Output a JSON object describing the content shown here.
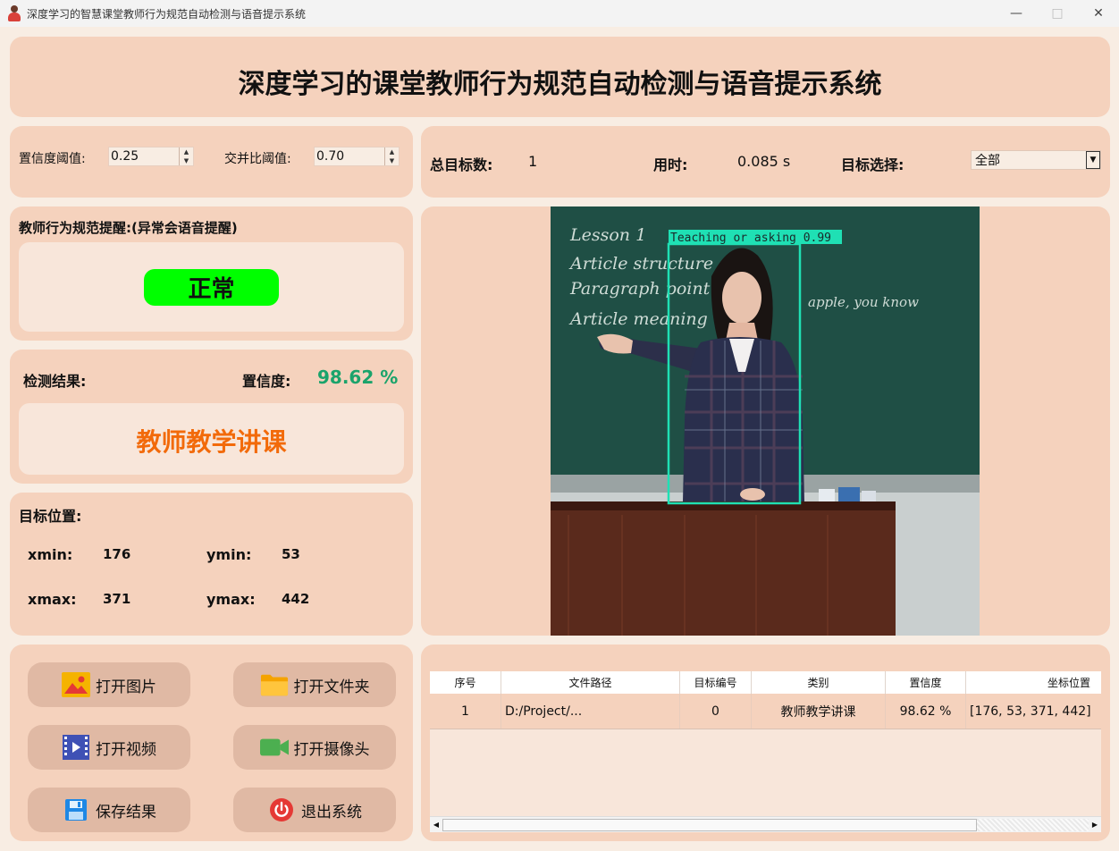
{
  "window": {
    "title": "深度学习的智慧课堂教师行为规范自动检测与语音提示系统"
  },
  "header": {
    "title": "深度学习的课堂教师行为规范自动检测与语音提示系统"
  },
  "params": {
    "conf_label": "置信度阈值:",
    "conf_value": "0.25",
    "iou_label": "交并比阈值:",
    "iou_value": "0.70"
  },
  "stats": {
    "total_label": "总目标数:",
    "total_value": "1",
    "time_label": "用时:",
    "time_value": "0.085 s",
    "target_label": "目标选择:",
    "target_value": "全部"
  },
  "reminder": {
    "label": "教师行为规范提醒:(异常会语音提醒)",
    "status": "正常",
    "status_color": "#00ff00"
  },
  "detection": {
    "label": "检测结果:",
    "conf_label": "置信度:",
    "conf_value": "98.62 %",
    "result": "教师教学讲课"
  },
  "position": {
    "label": "目标位置:",
    "xmin_label": "xmin:",
    "xmin": "176",
    "ymin_label": "ymin:",
    "ymin": "53",
    "xmax_label": "xmax:",
    "xmax": "371",
    "ymax_label": "ymax:",
    "ymax": "442"
  },
  "buttons": {
    "open_image": "打开图片",
    "open_folder": "打开文件夹",
    "open_video": "打开视频",
    "open_camera": "打开摄像头",
    "save": "保存结果",
    "exit": "退出系统"
  },
  "image": {
    "board_text": [
      "Lesson 1",
      "Article structure",
      "Paragraph point",
      "Article meaning",
      "apple, you know"
    ],
    "box_label": "Teaching or asking 0.99",
    "box_color": "#1fe0b4"
  },
  "table": {
    "headers": [
      "序号",
      "文件路径",
      "目标编号",
      "类别",
      "置信度",
      "坐标位置"
    ],
    "rows": [
      [
        "1",
        "D:/Project/...",
        "0",
        "教师教学讲课",
        "98.62 %",
        "[176, 53, 371, 442]"
      ]
    ]
  },
  "colors": {
    "panel": "#f5d2bd",
    "inner": "#f8e6da",
    "result": "#f26a0a",
    "confidence": "#1ba36b"
  }
}
